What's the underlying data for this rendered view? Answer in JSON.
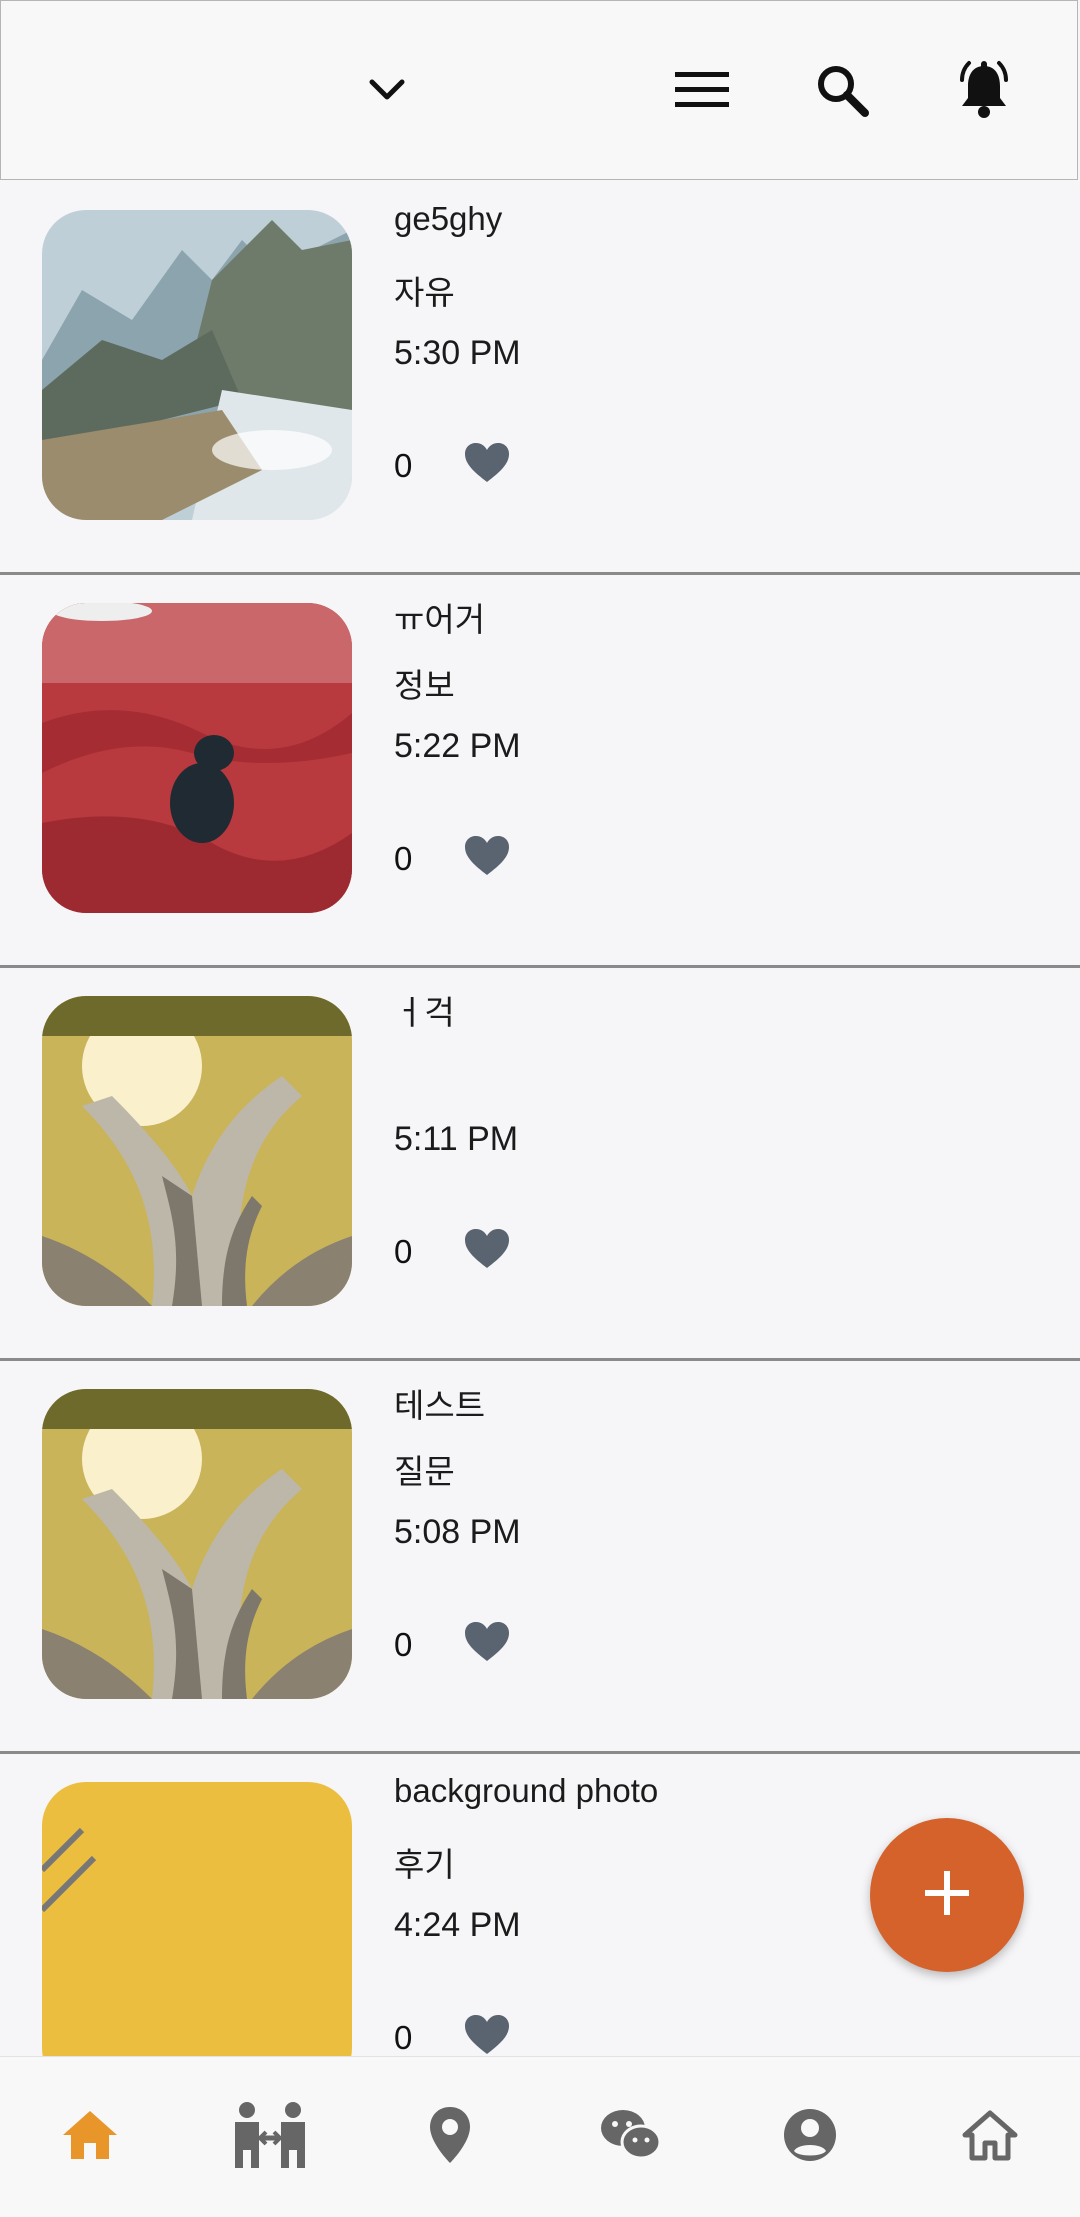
{
  "header": {
    "icons": [
      "chevron-down-icon",
      "menu-icon",
      "search-icon",
      "notification-bell-icon"
    ]
  },
  "posts": [
    {
      "title": "ge5ghy",
      "category": "자유",
      "time": "5:30 PM",
      "likes": "0",
      "image": "mountain-river-painting"
    },
    {
      "title": "ㅠ어거",
      "category": "정보",
      "time": "5:22 PM",
      "likes": "0",
      "image": "dog-in-red-nets"
    },
    {
      "title": "ㅓ걱",
      "category": "",
      "time": "5:11 PM",
      "likes": "0",
      "image": "giant-tree"
    },
    {
      "title": "테스트",
      "category": "질문",
      "time": "5:08 PM",
      "likes": "0",
      "image": "giant-tree"
    },
    {
      "title": "background photo",
      "category": "후기",
      "time": "4:24 PM",
      "likes": "0",
      "image": "yellow-background-pencils"
    }
  ],
  "fab": {
    "icon": "plus-icon"
  },
  "bottom_nav": {
    "items": [
      {
        "icon": "home-icon",
        "active": true
      },
      {
        "icon": "friends-icon",
        "active": false
      },
      {
        "icon": "location-pin-icon",
        "active": false
      },
      {
        "icon": "chat-icon",
        "active": false
      },
      {
        "icon": "profile-icon",
        "active": false
      },
      {
        "icon": "house-outline-icon",
        "active": false
      }
    ]
  },
  "colors": {
    "accent": "#d4622a",
    "nav_active": "#e8962a",
    "nav_inactive": "#666666",
    "heart": "#5a6470",
    "divider": "#8a8a8a"
  }
}
